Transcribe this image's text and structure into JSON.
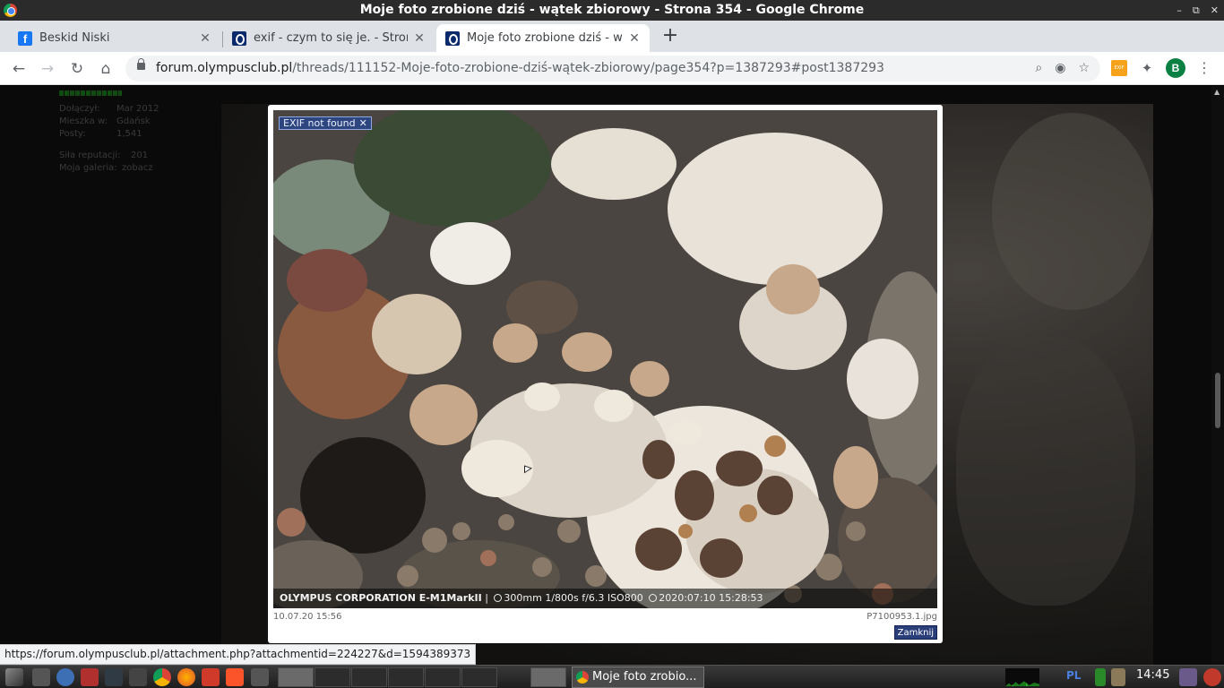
{
  "window": {
    "title": "Moje foto zrobione dziś - wątek zbiorowy - Strona 354 - Google Chrome",
    "controls": [
      "–",
      "⧉",
      "✕"
    ]
  },
  "tabs": [
    {
      "label": "Beskid Niski",
      "icon": "facebook-icon"
    },
    {
      "label": "exif - czym to się je. - Stron",
      "icon": "olympus-icon"
    },
    {
      "label": "Moje foto zrobione dziś - w",
      "icon": "olympus-icon"
    }
  ],
  "toolbar": {
    "url_host": "forum.olympusclub.pl",
    "url_path": "/threads/111152-Moje-foto-zrobione-dziś-wątek-zbiorowy/page354?p=1387293#post1387293",
    "profile_initial": "B",
    "exif_ext_label": "EXIF"
  },
  "profile": {
    "rows": [
      {
        "k": "Dołączył:",
        "v": "Mar 2012"
      },
      {
        "k": "Mieszka w:",
        "v": "Gdańsk"
      },
      {
        "k": "Posty:",
        "v": "1,541"
      }
    ],
    "rows2": [
      {
        "k": "Siła reputacji:",
        "v": "201"
      },
      {
        "k": "Moja galeria:",
        "v": "zobacz"
      }
    ]
  },
  "lightbox": {
    "exif_badge": "EXIF not found",
    "exif_camera": "OLYMPUS CORPORATION  E-M1MarkII",
    "exif_settings": "300mm 1/800s f/6.3 ISO800",
    "exif_datetime": "2020:07:10 15:28:53",
    "date": "10.07.20 15:56",
    "filename": "P7100953.1.jpg",
    "close_label": "Zamknij"
  },
  "status_url": "https://forum.olympusclub.pl/attachment.php?attachmentid=224227&d=1594389373",
  "taskbar": {
    "window_label": "Moje foto zrobio...",
    "lang": "PL",
    "clock": "14:45"
  },
  "colors": {
    "titlebar": "#2b2b2b",
    "tabstrip": "#dee1e6",
    "close_button": "#2a3f7a",
    "exif_badge": "#28468c"
  }
}
